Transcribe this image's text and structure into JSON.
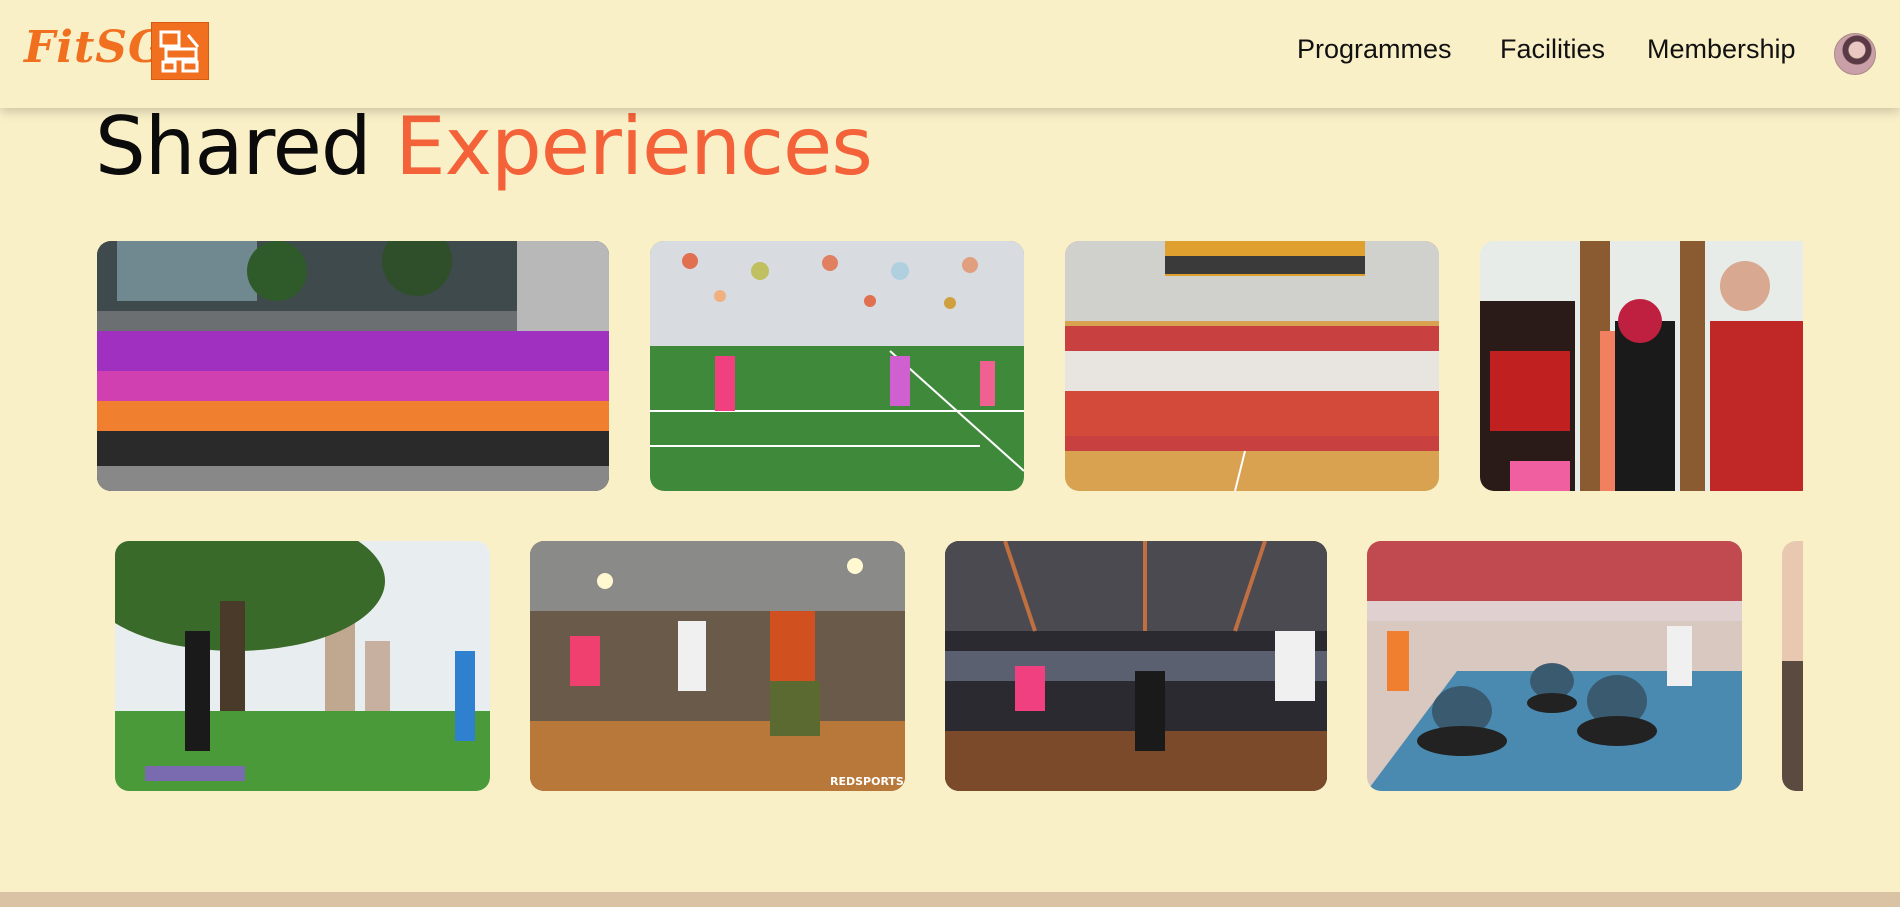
{
  "brand": {
    "name": "FitSG",
    "logo_icon": "fitness-equipment-icon",
    "color": "#f07020"
  },
  "nav": {
    "programmes": "Programmes",
    "facilities": "Facilities",
    "membership": "Membership"
  },
  "section": {
    "title_plain": "Shared",
    "title_accent": "Experiences",
    "accent_color": "#f4623a"
  },
  "gallery": {
    "row1": [
      "group-photo-purple-shirts",
      "indoor-turf-lanterns",
      "hall-group-photo-kids",
      "aerobics-class"
    ],
    "row2": [
      "park-exercise-class",
      "studio-dance-class",
      "sports-hall-zumba",
      "kids-balance-balls",
      "partial-photo"
    ],
    "watermark": "REDSPORTS.SG"
  },
  "colors": {
    "background": "#faf0c8",
    "footer": "#d9c3a4"
  }
}
